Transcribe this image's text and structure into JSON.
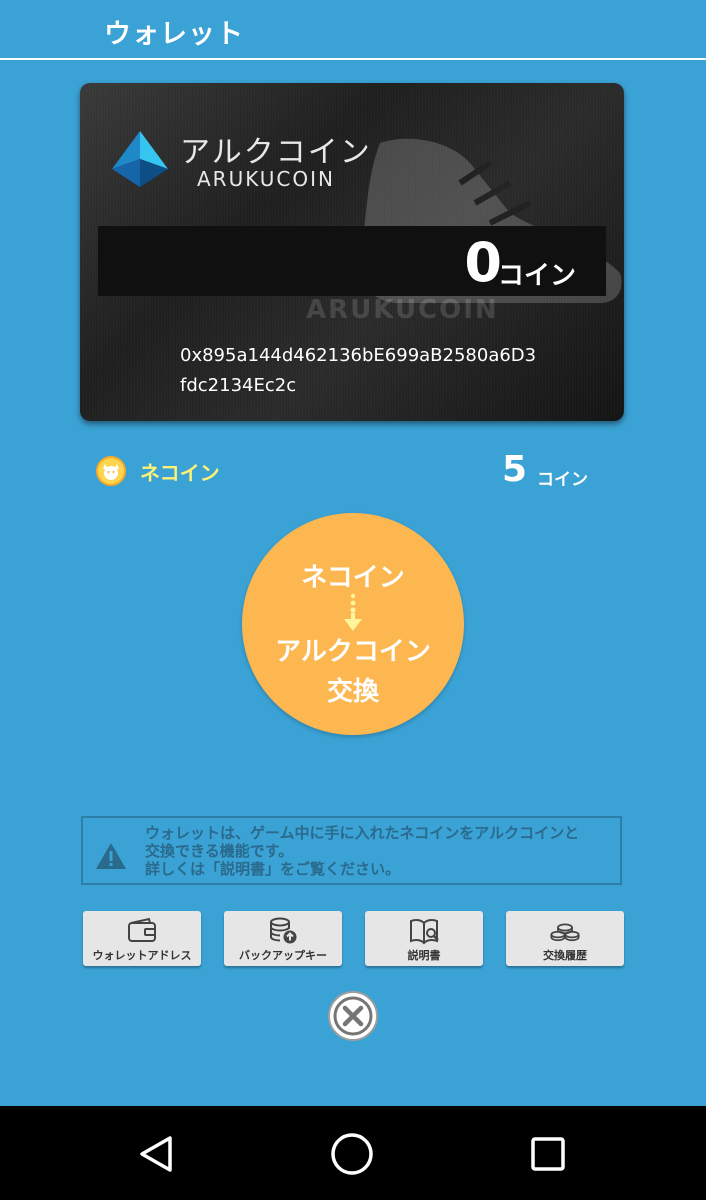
{
  "header": {
    "title": "ウォレット"
  },
  "card": {
    "brand_ja": "アルクコイン",
    "brand_en": "ARUKUCOIN",
    "watermark": "ARUKUCOIN",
    "balance": "0",
    "balance_unit": "コイン",
    "address": "0x895a144d462136bE699aB2580a6D3fdc2134Ec2c"
  },
  "neko": {
    "label": "ネコイン",
    "value": "5",
    "unit": "コイン"
  },
  "exchange": {
    "line1": "ネコイン",
    "line2": "アルクコイン",
    "line3": "交換"
  },
  "notice": {
    "text_line1": "ウォレットは、ゲーム中に手に入れたネコインをアルクコインと",
    "text_line2": "交換できる機能です。",
    "text_line3": "詳しくは「説明書」をご覧ください。"
  },
  "buttons": [
    {
      "label": "ウォレットアドレス",
      "icon": "wallet-icon"
    },
    {
      "label": "バックアップキー",
      "icon": "database-backup-icon"
    },
    {
      "label": "説明書",
      "icon": "manual-book-icon"
    },
    {
      "label": "交換履歴",
      "icon": "coins-history-icon"
    }
  ],
  "colors": {
    "background": "#3BA2D5",
    "exchange_button": "#FDB751",
    "neko_label": "#FFF176",
    "notice_text": "#2A6A8C"
  }
}
